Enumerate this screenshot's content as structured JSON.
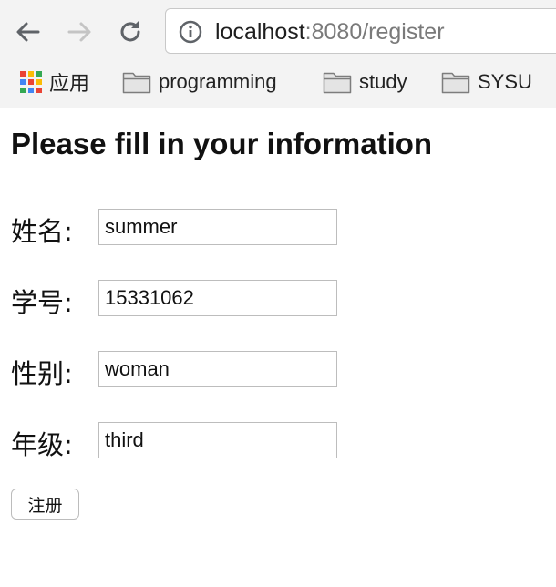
{
  "browser": {
    "url_host": "localhost",
    "url_rest": ":8080/register",
    "bookmarks": [
      {
        "label": "应用",
        "icon": "apps-grid-icon"
      },
      {
        "label": "programming",
        "icon": "folder-icon"
      },
      {
        "label": "study",
        "icon": "folder-icon"
      },
      {
        "label": "SYSU",
        "icon": "folder-icon"
      }
    ]
  },
  "form": {
    "title": "Please fill in your information",
    "fields": [
      {
        "label": "姓名:",
        "value": "summer"
      },
      {
        "label": "学号:",
        "value": "15331062"
      },
      {
        "label": "性别:",
        "value": "woman"
      },
      {
        "label": "年级:",
        "value": "third"
      }
    ],
    "submit_label": "注册"
  },
  "colors": {
    "toolbar_bg": "#f3f3f3",
    "url_host": "#1f1f1f",
    "url_path": "#7a7a7a"
  }
}
